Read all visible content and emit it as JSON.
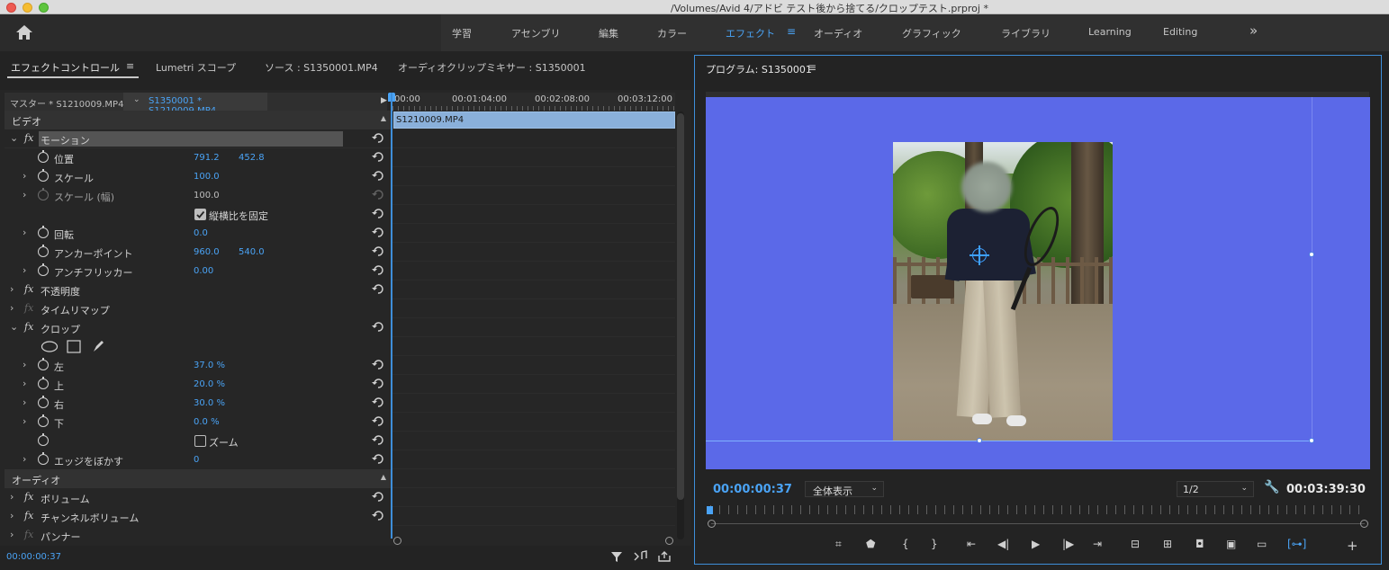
{
  "window": {
    "title": "/Volumes/Avid 4/アドビ テスト後から捨てる/クロップテスト.prproj *"
  },
  "workspaces": {
    "tabs": [
      "学習",
      "アセンブリ",
      "編集",
      "カラー",
      "エフェクト",
      "オーディオ",
      "グラフィック",
      "ライブラリ",
      "Learning",
      "Editing"
    ],
    "active": "エフェクト",
    "more": "»"
  },
  "left_panel": {
    "tabs": {
      "effect_controls": "エフェクトコントロール",
      "lumetri": "Lumetri スコープ",
      "source": "ソース : S1350001.MP4",
      "audio_mixer": "オーディオクリップミキサー : S1350001"
    },
    "master_clip": "マスター * S1210009.MP4",
    "sequence_clip": "S1350001 * S1210009.MP4",
    "timecodes": [
      "00:00",
      "00:01:04:00",
      "00:02:08:00",
      "00:03:12:00"
    ],
    "timeline_clip": "S1210009.MP4",
    "sections": {
      "video": "ビデオ",
      "audio": "オーディオ"
    },
    "effects": {
      "motion": {
        "name": "モーション",
        "position": {
          "label": "位置",
          "x": "791.2",
          "y": "452.8"
        },
        "scale": {
          "label": "スケール",
          "value": "100.0"
        },
        "scale_width": {
          "label": "スケール (幅)",
          "value": "100.0"
        },
        "uniform_scale": {
          "label": "縦横比を固定",
          "checked": true
        },
        "rotation": {
          "label": "回転",
          "value": "0.0"
        },
        "anchor": {
          "label": "アンカーポイント",
          "x": "960.0",
          "y": "540.0"
        },
        "antiflicker": {
          "label": "アンチフリッカー",
          "value": "0.00"
        }
      },
      "opacity": {
        "name": "不透明度"
      },
      "time_remap": {
        "name": "タイムリマップ"
      },
      "crop": {
        "name": "クロップ",
        "left": {
          "label": "左",
          "value": "37.0 %"
        },
        "top": {
          "label": "上",
          "value": "20.0 %"
        },
        "right": {
          "label": "右",
          "value": "30.0 %"
        },
        "bottom": {
          "label": "下",
          "value": "0.0 %"
        },
        "zoom": {
          "label": "ズーム",
          "checked": false
        },
        "feather": {
          "label": "エッジをぼかす",
          "value": "0"
        }
      },
      "volume": {
        "name": "ボリューム"
      },
      "channel_volume": {
        "name": "チャンネルボリューム"
      },
      "panner": {
        "name": "パンナー"
      }
    },
    "current_timecode": "00:00:00:37"
  },
  "program_monitor": {
    "title": "プログラム: S1350001",
    "current_timecode": "00:00:00:37",
    "fit": "全体表示",
    "resolution": "1/2",
    "duration": "00:03:39:30",
    "background_color": "#5b69e8"
  },
  "colors": {
    "accent": "#4aa3f5",
    "panel_bg": "#232323"
  }
}
